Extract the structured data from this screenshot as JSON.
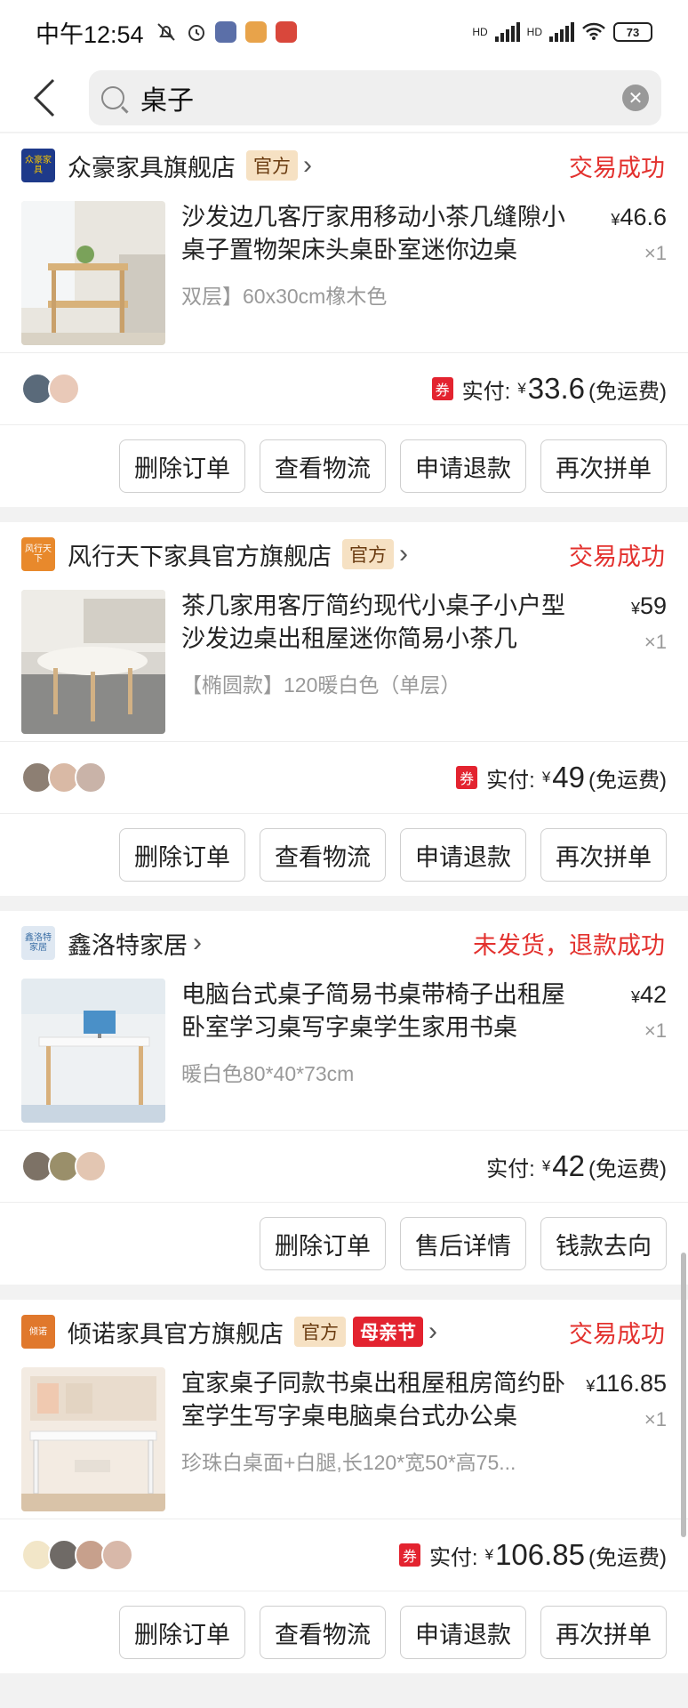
{
  "status_bar": {
    "time": "中午12:54",
    "network_label": "HD",
    "battery": "73"
  },
  "search": {
    "query": "桌子"
  },
  "orders": [
    {
      "shop": "众豪家具旗舰店",
      "logo_text": "众豪家具",
      "official": "官方",
      "status": "交易成功",
      "title": "沙发边几客厅家用移动小茶几缝隙小桌子置物架床头桌卧室迷你边桌",
      "spec": "双层】60x30cm橡木色",
      "price": "46.6",
      "qty": "×1",
      "coupon": "券",
      "pay_label": "实付:",
      "pay_amount": "33.6",
      "shipping": "(免运费)",
      "buttons": [
        "删除订单",
        "查看物流",
        "申请退款",
        "再次拼单"
      ]
    },
    {
      "shop": "风行天下家具官方旗舰店",
      "logo_text": "风行天下",
      "official": "官方",
      "status": "交易成功",
      "title": "茶几家用客厅简约现代小桌子小户型沙发边桌出租屋迷你简易小茶几",
      "spec": "【椭圆款】120暖白色（单层）",
      "price": "59",
      "qty": "×1",
      "coupon": "券",
      "pay_label": "实付:",
      "pay_amount": "49",
      "shipping": "(免运费)",
      "buttons": [
        "删除订单",
        "查看物流",
        "申请退款",
        "再次拼单"
      ]
    },
    {
      "shop": "鑫洛特家居",
      "logo_text": "鑫洛特家居",
      "status": "未发货，退款成功",
      "title": "电脑台式桌子简易书桌带椅子出租屋卧室学习桌写字桌学生家用书桌",
      "spec": "暖白色80*40*73cm",
      "price": "42",
      "qty": "×1",
      "pay_label": "实付:",
      "pay_amount": "42",
      "shipping": "(免运费)",
      "buttons": [
        "删除订单",
        "售后详情",
        "钱款去向"
      ]
    },
    {
      "shop": "倾诺家具官方旗舰店",
      "logo_text": "倾诺",
      "official": "官方",
      "promo": "母亲节",
      "status": "交易成功",
      "title": "宜家桌子同款书桌出租屋租房简约卧室学生写字桌电脑桌台式办公桌",
      "spec": "珍珠白桌面+白腿,长120*宽50*高75...",
      "price": "116.85",
      "qty": "×1",
      "coupon": "券",
      "pay_label": "实付:",
      "pay_amount": "106.85",
      "shipping": "(免运费)",
      "buttons": [
        "删除订单",
        "查看物流",
        "申请退款",
        "再次拼单"
      ]
    }
  ],
  "yen": "¥",
  "colors": {
    "status_red": "#e3312e",
    "official_bg": "#f6e1c3",
    "promo_red": "#e3232f"
  }
}
